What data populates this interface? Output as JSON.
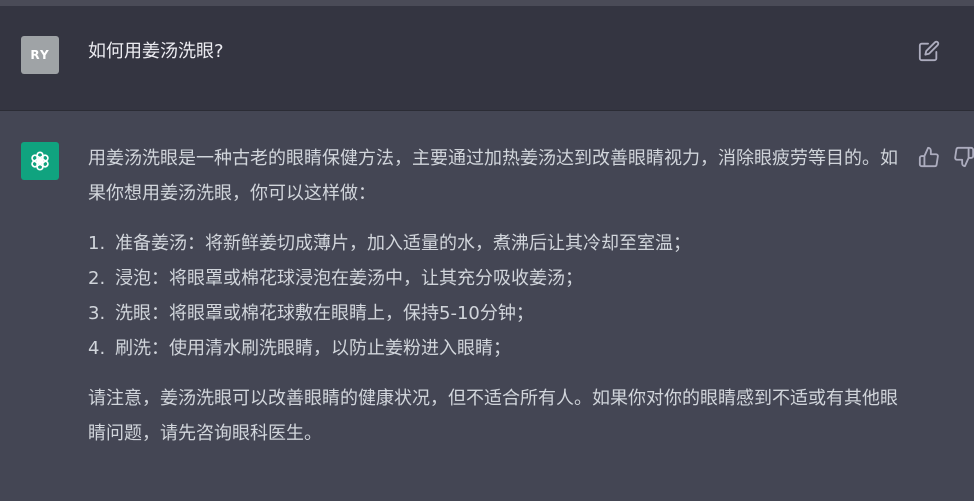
{
  "user_message": {
    "avatar_initials": "RY",
    "text": "如何用姜汤洗眼?"
  },
  "assistant_message": {
    "intro": "用姜汤洗眼是一种古老的眼睛保健方法，主要通过加热姜汤达到改善眼睛视力，消除眼疲劳等目的。如果你想用姜汤洗眼，你可以这样做：",
    "steps": [
      {
        "number": "1.",
        "text": "准备姜汤：将新鲜姜切成薄片，加入适量的水，煮沸后让其冷却至室温；"
      },
      {
        "number": "2.",
        "text": "浸泡：将眼罩或棉花球浸泡在姜汤中，让其充分吸收姜汤；"
      },
      {
        "number": "3.",
        "text": "洗眼：将眼罩或棉花球敷在眼睛上，保持5-10分钟；"
      },
      {
        "number": "4.",
        "text": "刷洗：使用清水刷洗眼睛，以防止姜粉进入眼睛；"
      }
    ],
    "note": "请注意，姜汤洗眼可以改善眼睛的健康状况，但不适合所有人。如果你对你的眼睛感到不适或有其他眼睛问题，请先咨询眼科医生。"
  },
  "icons": {
    "edit": "edit-icon",
    "thumbs_up": "thumbs-up-icon",
    "thumbs_down": "thumbs-down-icon",
    "assistant_logo": "openai-logo-icon"
  },
  "colors": {
    "user_bg": "#343541",
    "assistant_bg": "#444654",
    "bot_avatar": "#10a37f",
    "user_avatar": "#9fa3a6"
  }
}
